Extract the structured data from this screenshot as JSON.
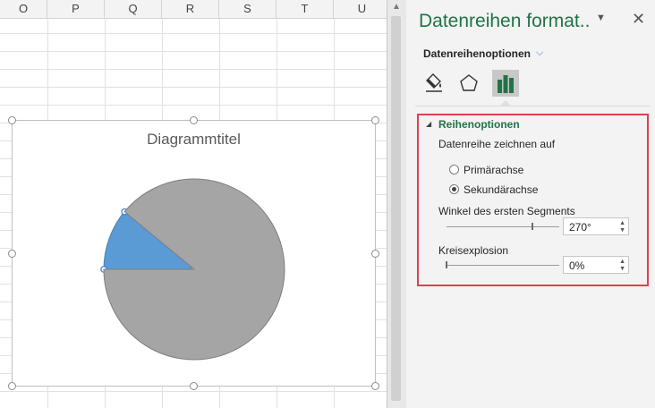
{
  "sheet": {
    "columns": [
      "O",
      "P",
      "Q",
      "R",
      "S",
      "T",
      "U"
    ]
  },
  "chart": {
    "title": "Diagrammtitel"
  },
  "chart_data": {
    "type": "pie",
    "title": "Diagrammtitel",
    "series": [
      {
        "name": "",
        "values": [],
        "note": ""
      }
    ],
    "slices": [
      {
        "label": "",
        "percent": 11,
        "color": "#5b9bd5",
        "selected": true
      },
      {
        "label": "",
        "percent": 89,
        "color": "#a5a5a5",
        "selected": false
      }
    ],
    "first_slice_angle_deg": 270
  },
  "pane": {
    "title": "Datenreihen format..",
    "dropdown_icon": "caret-down-icon",
    "close_icon": "close-icon",
    "options_label": "Datenreihenoptionen",
    "tabs": [
      {
        "name": "fill-line-icon"
      },
      {
        "name": "effects-pentagon-icon"
      },
      {
        "name": "series-options-bar-icon",
        "active": true
      }
    ],
    "section": {
      "title": "Reihenoptionen",
      "plot_on_label": "Datenreihe zeichnen auf",
      "primary_axis": "Primärachse",
      "secondary_axis": "Sekundärachse",
      "selected_axis": "secondary",
      "angle_label": "Winkel des ersten Segments",
      "angle_value": "270°",
      "explosion_label": "Kreisexplosion",
      "explosion_value": "0%"
    },
    "accent_color": "#217346",
    "highlight_color": "#e0404b"
  }
}
